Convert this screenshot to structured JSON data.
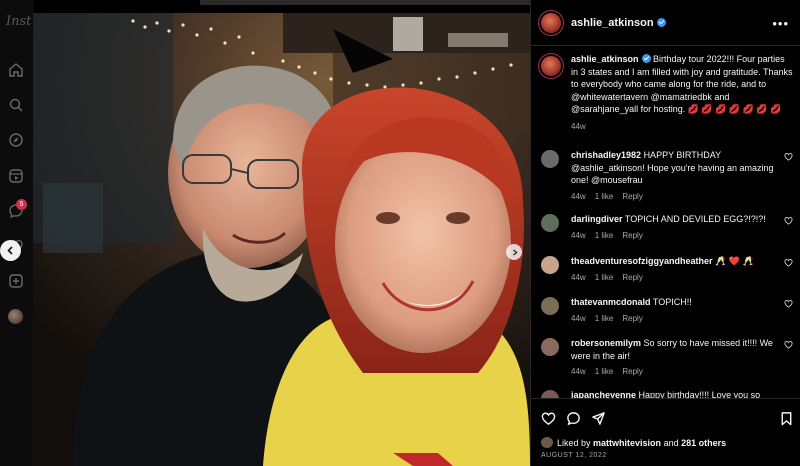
{
  "sidebar": {
    "logo": "Inst",
    "messages_badge": "5",
    "icons": [
      "home-icon",
      "search-icon",
      "explore-icon",
      "reels-icon",
      "messages-icon",
      "notifications-icon",
      "create-icon",
      "profile-avatar"
    ]
  },
  "post": {
    "username": "ashlie_atkinson",
    "verified": true,
    "caption_text": "Birthday tour 2022!!! Four parties in 3 states and I am filled with joy and gratitude. Thanks to everybody who came along for the ride, and to @whitewatertavern @mamatriedbk and @sarahjane_yall for hosting. 💋 💋 💋 💋 💋 💋 💋",
    "caption_time": "44w",
    "likes_prefix": "Liked by",
    "likes_user": "mattwhitevision",
    "likes_connector": "and",
    "likes_others": "281 others",
    "date": "AUGUST 12, 2022"
  },
  "comments": [
    {
      "user": "chrishadley1982",
      "text": "HAPPY BIRTHDAY @ashlie_atkinson! Hope you're having an amazing one! @mousefrau",
      "time": "44w",
      "likes": "1 like",
      "reply": "Reply",
      "avatar_color": "#6a6a6a"
    },
    {
      "user": "darlingdiver",
      "text": "TOPICH AND DEVILED EGG?!?!?!",
      "time": "44w",
      "likes": "1 like",
      "reply": "Reply",
      "avatar_color": "#5d6e5a"
    },
    {
      "user": "theadventuresofziggyandheather",
      "text": "🥂 ❤️ 🥂",
      "time": "44w",
      "likes": "1 like",
      "reply": "Reply",
      "avatar_color": "#c9a48a"
    },
    {
      "user": "thatevanmcdonald",
      "text": "TOPICH!!",
      "time": "44w",
      "likes": "1 like",
      "reply": "Reply",
      "avatar_color": "#7a6e56"
    },
    {
      "user": "robersonemilym",
      "text": "So sorry to have missed it!!!! We were in the air!",
      "time": "44w",
      "likes": "1 like",
      "reply": "Reply",
      "avatar_color": "#8a6a5e"
    },
    {
      "user": "japancheyenne",
      "text": "Happy birthday!!!! Love you so",
      "time": "",
      "likes": "",
      "reply": "",
      "avatar_color": "#7a5a58"
    }
  ],
  "actions": [
    "heart-icon",
    "comment-icon",
    "share-icon",
    "bookmark-icon"
  ]
}
